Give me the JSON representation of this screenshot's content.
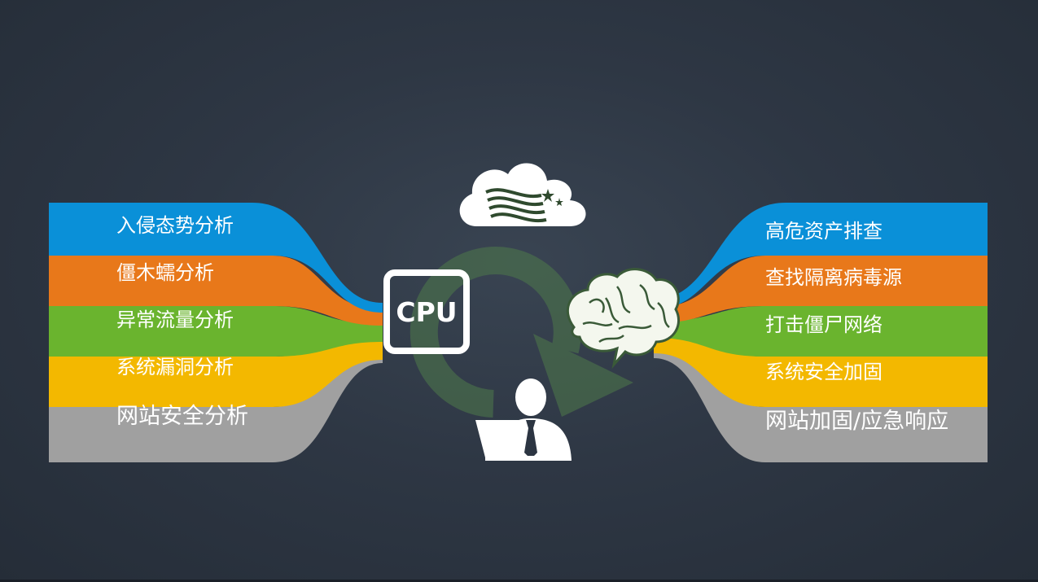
{
  "left_items": [
    {
      "label": "入侵态势分析",
      "color": "#0a90d8"
    },
    {
      "label": "僵木蠕分析",
      "color": "#e8781a"
    },
    {
      "label": "异常流量分析",
      "color": "#6ab42e"
    },
    {
      "label": "系统漏洞分析",
      "color": "#f3b800"
    },
    {
      "label": "网站安全分析",
      "color": "#a0a0a0"
    }
  ],
  "right_items": [
    {
      "label": "高危资产排查",
      "color": "#0a90d8"
    },
    {
      "label": "查找隔离病毒源",
      "color": "#e8781a"
    },
    {
      "label": "打击僵尸网络",
      "color": "#6ab42e"
    },
    {
      "label": "系统安全加固",
      "color": "#f3b800"
    },
    {
      "label": "网站加固/应急响应",
      "color": "#a0a0a0"
    }
  ],
  "center": {
    "cpu_label": "CPU",
    "icons": [
      "cloud-icon",
      "brain-icon",
      "analyst-at-laptop-icon",
      "cycle-arrow-icon",
      "cpu-chip-icon"
    ]
  }
}
